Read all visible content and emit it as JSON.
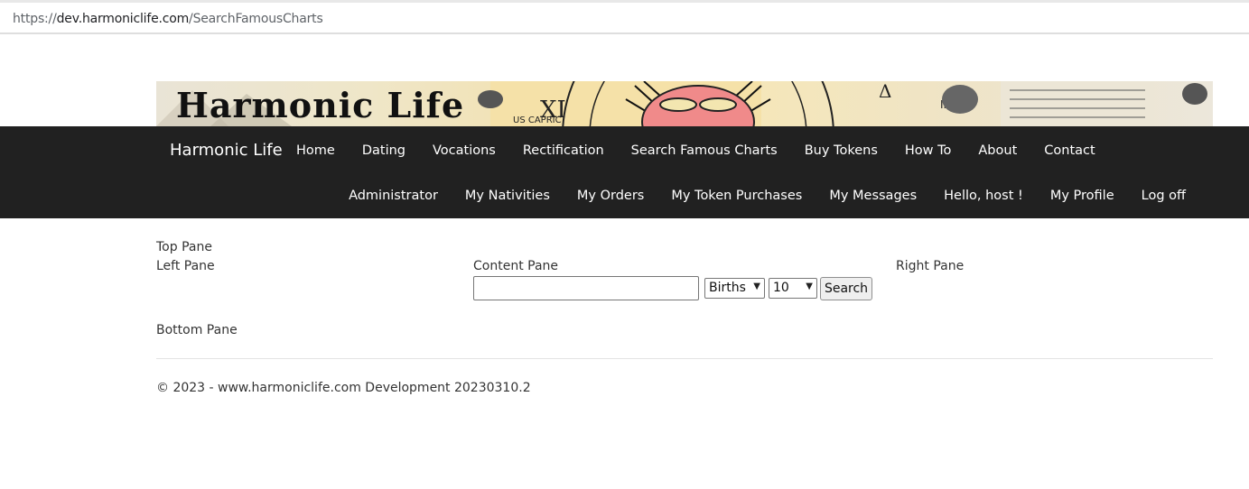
{
  "browser": {
    "url_scheme": "https://",
    "url_host": "dev.harmoniclife.com",
    "url_path": "/SearchFamousCharts"
  },
  "banner": {
    "logo_text": "Harmonic Life"
  },
  "navbar": {
    "brand": "Harmonic Life",
    "main_items": [
      "Home",
      "Dating",
      "Vocations",
      "Rectification",
      "Search Famous Charts",
      "Buy Tokens",
      "How To",
      "About",
      "Contact"
    ],
    "user_items": [
      "Administrator",
      "My Nativities",
      "My Orders",
      "My Token Purchases",
      "My Messages",
      "Hello, host !",
      "My Profile",
      "Log off"
    ]
  },
  "panes": {
    "top": "Top Pane",
    "left": "Left Pane",
    "content": "Content Pane",
    "right": "Right Pane",
    "bottom": "Bottom Pane"
  },
  "search": {
    "query_value": "",
    "type_selected": "Births",
    "count_selected": "10",
    "button_label": "Search"
  },
  "footer": {
    "text": "© 2023 - www.harmoniclife.com Development 20230310.2"
  }
}
